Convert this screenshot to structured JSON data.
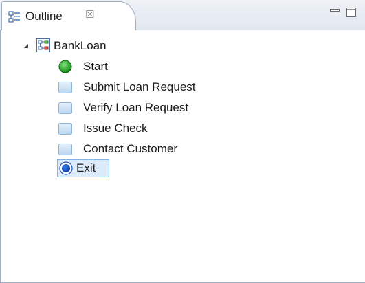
{
  "tab": {
    "label": "Outline",
    "icon": "outline-icon",
    "close_glyph": "☒"
  },
  "window_controls": {
    "minimize_icon": "minimize-icon",
    "maximize_icon": "maximize-icon"
  },
  "tree": {
    "root": {
      "label": "BankLoan",
      "icon": "process-diagram-icon",
      "expanded": true
    },
    "items": [
      {
        "label": "Start",
        "icon": "start-event-icon",
        "selected": false
      },
      {
        "label": "Submit Loan Request",
        "icon": "task-icon",
        "selected": false
      },
      {
        "label": "Verify Loan Request",
        "icon": "task-icon",
        "selected": false
      },
      {
        "label": "Issue Check",
        "icon": "task-icon",
        "selected": false
      },
      {
        "label": "Contact Customer",
        "icon": "task-icon",
        "selected": false
      },
      {
        "label": "Exit",
        "icon": "end-event-icon",
        "selected": true
      }
    ]
  },
  "colors": {
    "start_event": "#1aa31a",
    "end_event": "#1f5fd6",
    "task_fill": "#cfe4f7",
    "selection_fill": "#dcebfc",
    "selection_border": "#7eb4ea"
  }
}
